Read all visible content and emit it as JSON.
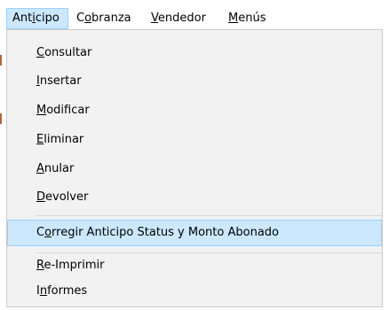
{
  "menubar": {
    "items": [
      {
        "pre": "Ant",
        "key": "i",
        "post": "cipo"
      },
      {
        "pre": "C",
        "key": "o",
        "post": "branza"
      },
      {
        "pre": "",
        "key": "V",
        "post": "endedor"
      },
      {
        "pre": "",
        "key": "M",
        "post": "enús"
      }
    ]
  },
  "dropdown": {
    "items": [
      {
        "pre": "",
        "key": "C",
        "post": "onsultar"
      },
      {
        "pre": "",
        "key": "I",
        "post": "nsertar"
      },
      {
        "pre": "",
        "key": "M",
        "post": "odificar"
      },
      {
        "pre": "",
        "key": "E",
        "post": "liminar"
      },
      {
        "pre": "",
        "key": "A",
        "post": "nular"
      },
      {
        "pre": "",
        "key": "D",
        "post": "evolver"
      },
      {
        "pre": "C",
        "key": "o",
        "post": "rregir Anticipo Status y Monto Abonado"
      },
      {
        "pre": "",
        "key": "R",
        "post": "e-Imprimir"
      },
      {
        "pre": "I",
        "key": "n",
        "post": "formes"
      }
    ]
  },
  "colors": {
    "highlight": "#cce8ff",
    "highlight_border": "#99d1ff",
    "menu_background": "#f2f2f2"
  }
}
